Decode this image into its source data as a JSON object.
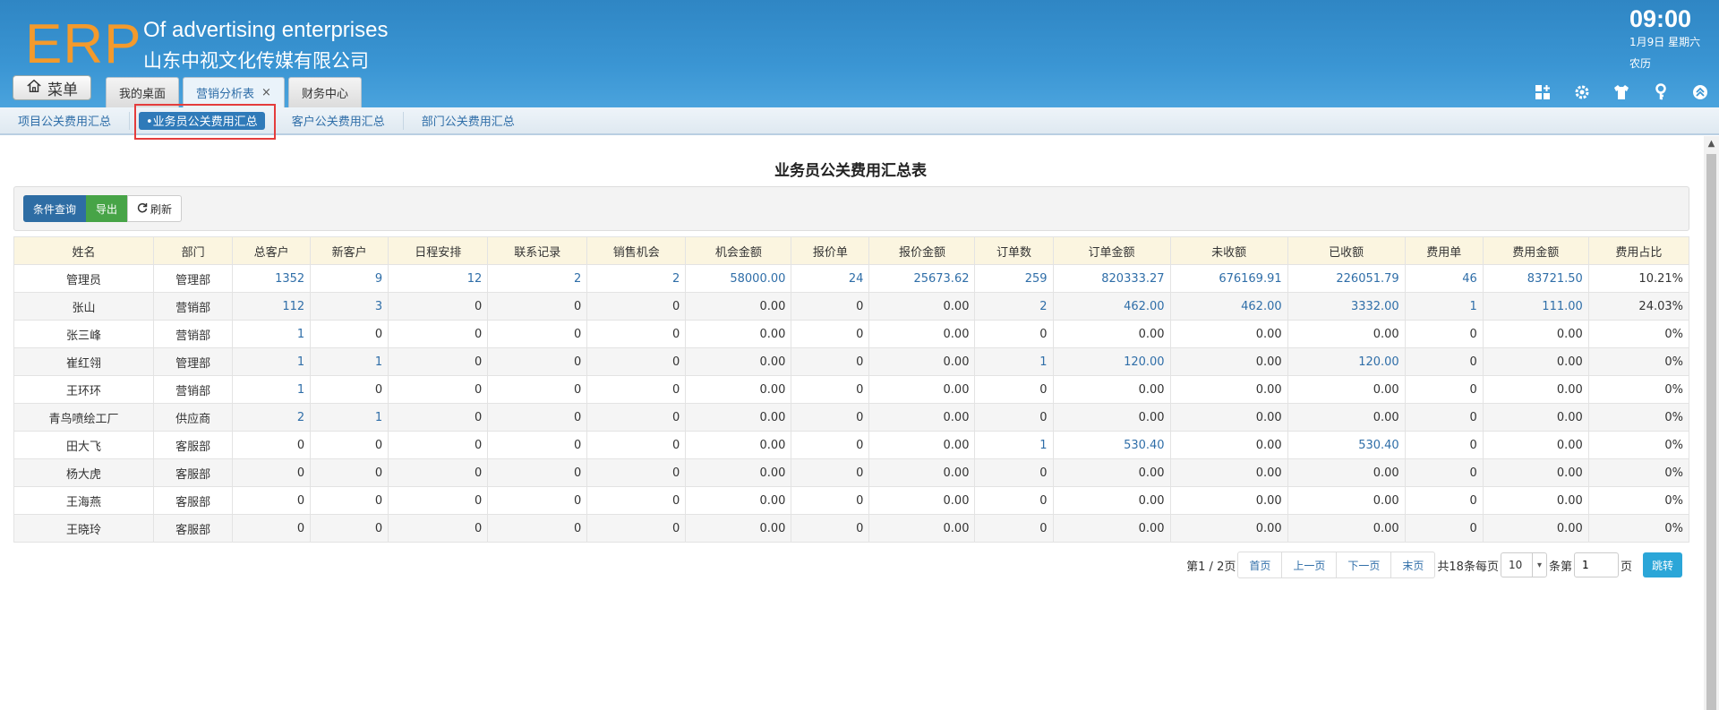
{
  "header": {
    "logo": "ERP",
    "company_en": "Of advertising enterprises",
    "company_cn": "山东中视文化传媒有限公司",
    "menu_label": "菜单",
    "tabs": [
      {
        "label": "我的桌面"
      },
      {
        "label": "营销分析表",
        "close": "×"
      },
      {
        "label": "财务中心"
      }
    ],
    "clock": "09:00",
    "date": "1月9日 星期六",
    "lunar": "农历",
    "tools": [
      "grid-add-icon",
      "gear-icon",
      "shirt-icon",
      "key-icon",
      "collapse-up-icon"
    ]
  },
  "subnav": {
    "items": [
      "项目公关费用汇总",
      "•业务员公关费用汇总",
      "客户公关费用汇总",
      "部门公关费用汇总"
    ],
    "active_index": 1
  },
  "page": {
    "title": "业务员公关费用汇总表",
    "buttons": {
      "query": "条件查询",
      "export": "导出",
      "refresh": "刷新"
    }
  },
  "table": {
    "columns": [
      "姓名",
      "部门",
      "总客户",
      "新客户",
      "日程安排",
      "联系记录",
      "销售机会",
      "机会金额",
      "报价单",
      "报价金额",
      "订单数",
      "订单金额",
      "未收额",
      "已收额",
      "费用单",
      "费用金额",
      "费用占比"
    ],
    "rows": [
      [
        "管理员",
        "管理部",
        "1352",
        "9",
        "12",
        "2",
        "2",
        "58000.00",
        "24",
        "25673.62",
        "259",
        "820333.27",
        "676169.91",
        "226051.79",
        "46",
        "83721.50",
        "10.21%"
      ],
      [
        "张山",
        "营销部",
        "112",
        "3",
        "0",
        "0",
        "0",
        "0.00",
        "0",
        "0.00",
        "2",
        "462.00",
        "462.00",
        "3332.00",
        "1",
        "111.00",
        "24.03%"
      ],
      [
        "张三峰",
        "营销部",
        "1",
        "0",
        "0",
        "0",
        "0",
        "0.00",
        "0",
        "0.00",
        "0",
        "0.00",
        "0.00",
        "0.00",
        "0",
        "0.00",
        "0%"
      ],
      [
        "崔红翎",
        "管理部",
        "1",
        "1",
        "0",
        "0",
        "0",
        "0.00",
        "0",
        "0.00",
        "1",
        "120.00",
        "0.00",
        "120.00",
        "0",
        "0.00",
        "0%"
      ],
      [
        "王环环",
        "营销部",
        "1",
        "0",
        "0",
        "0",
        "0",
        "0.00",
        "0",
        "0.00",
        "0",
        "0.00",
        "0.00",
        "0.00",
        "0",
        "0.00",
        "0%"
      ],
      [
        "青鸟喷绘工厂",
        "供应商",
        "2",
        "1",
        "0",
        "0",
        "0",
        "0.00",
        "0",
        "0.00",
        "0",
        "0.00",
        "0.00",
        "0.00",
        "0",
        "0.00",
        "0%"
      ],
      [
        "田大飞",
        "客服部",
        "0",
        "0",
        "0",
        "0",
        "0",
        "0.00",
        "0",
        "0.00",
        "1",
        "530.40",
        "0.00",
        "530.40",
        "0",
        "0.00",
        "0%"
      ],
      [
        "杨大虎",
        "客服部",
        "0",
        "0",
        "0",
        "0",
        "0",
        "0.00",
        "0",
        "0.00",
        "0",
        "0.00",
        "0.00",
        "0.00",
        "0",
        "0.00",
        "0%"
      ],
      [
        "王海燕",
        "客服部",
        "0",
        "0",
        "0",
        "0",
        "0",
        "0.00",
        "0",
        "0.00",
        "0",
        "0.00",
        "0.00",
        "0.00",
        "0",
        "0.00",
        "0%"
      ],
      [
        "王晓玲",
        "客服部",
        "0",
        "0",
        "0",
        "0",
        "0",
        "0.00",
        "0",
        "0.00",
        "0",
        "0.00",
        "0.00",
        "0.00",
        "0",
        "0.00",
        "0%"
      ]
    ]
  },
  "pager": {
    "page_info": "第1 / 2页",
    "first": "首页",
    "prev": "上一页",
    "next": "下一页",
    "last": "末页",
    "total_text": "共18条每页",
    "page_size": "10",
    "per_unit": "条第",
    "page_input": "1",
    "page_unit": "页",
    "go": "跳转"
  },
  "colors": {
    "header_blue": "#3a95d3",
    "logo_orange": "#f39a2c",
    "link_blue": "#2f6ea8",
    "highlight_red": "#e43c3c"
  }
}
